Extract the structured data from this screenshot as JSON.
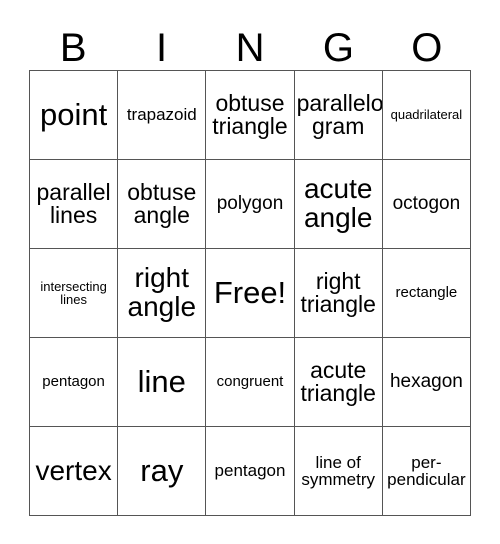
{
  "card": {
    "title_letters": [
      "B",
      "I",
      "N",
      "G",
      "O"
    ],
    "columns": 5,
    "rows": 5,
    "colors": {
      "background": "#ffffff",
      "text": "#000000",
      "grid_line": "#555555"
    },
    "cells": [
      {
        "text": "point",
        "size": "fs-xl"
      },
      {
        "text": "trapazoid",
        "size": "fs-xs"
      },
      {
        "text": "obtuse\ntriangle",
        "size": "fs-md"
      },
      {
        "text": "parallelo-\ngram",
        "size": "fs-md"
      },
      {
        "text": "quadrilateral",
        "size": "fs-tiny"
      },
      {
        "text": "parallel\nlines",
        "size": "fs-md"
      },
      {
        "text": "obtuse\nangle",
        "size": "fs-md"
      },
      {
        "text": "polygon",
        "size": "fs-sm"
      },
      {
        "text": "acute\nangle",
        "size": "fs-lg"
      },
      {
        "text": "octogon",
        "size": "fs-sm"
      },
      {
        "text": "intersecting\nlines",
        "size": "fs-tiny"
      },
      {
        "text": "right\nangle",
        "size": "fs-lg"
      },
      {
        "text": "Free!",
        "size": "fs-xl"
      },
      {
        "text": "right\ntriangle",
        "size": "fs-md"
      },
      {
        "text": "rectangle",
        "size": "fs-xxs"
      },
      {
        "text": "pentagon",
        "size": "fs-xxs"
      },
      {
        "text": "line",
        "size": "fs-xl"
      },
      {
        "text": "congruent",
        "size": "fs-xxs"
      },
      {
        "text": "acute\ntriangle",
        "size": "fs-md"
      },
      {
        "text": "hexagon",
        "size": "fs-sm"
      },
      {
        "text": "vertex",
        "size": "fs-lg"
      },
      {
        "text": "ray",
        "size": "fs-xl"
      },
      {
        "text": "pentagon",
        "size": "fs-xs"
      },
      {
        "text": "line of\nsymmetry",
        "size": "fs-xs"
      },
      {
        "text": "per-\npendicular",
        "size": "fs-xs"
      }
    ]
  }
}
